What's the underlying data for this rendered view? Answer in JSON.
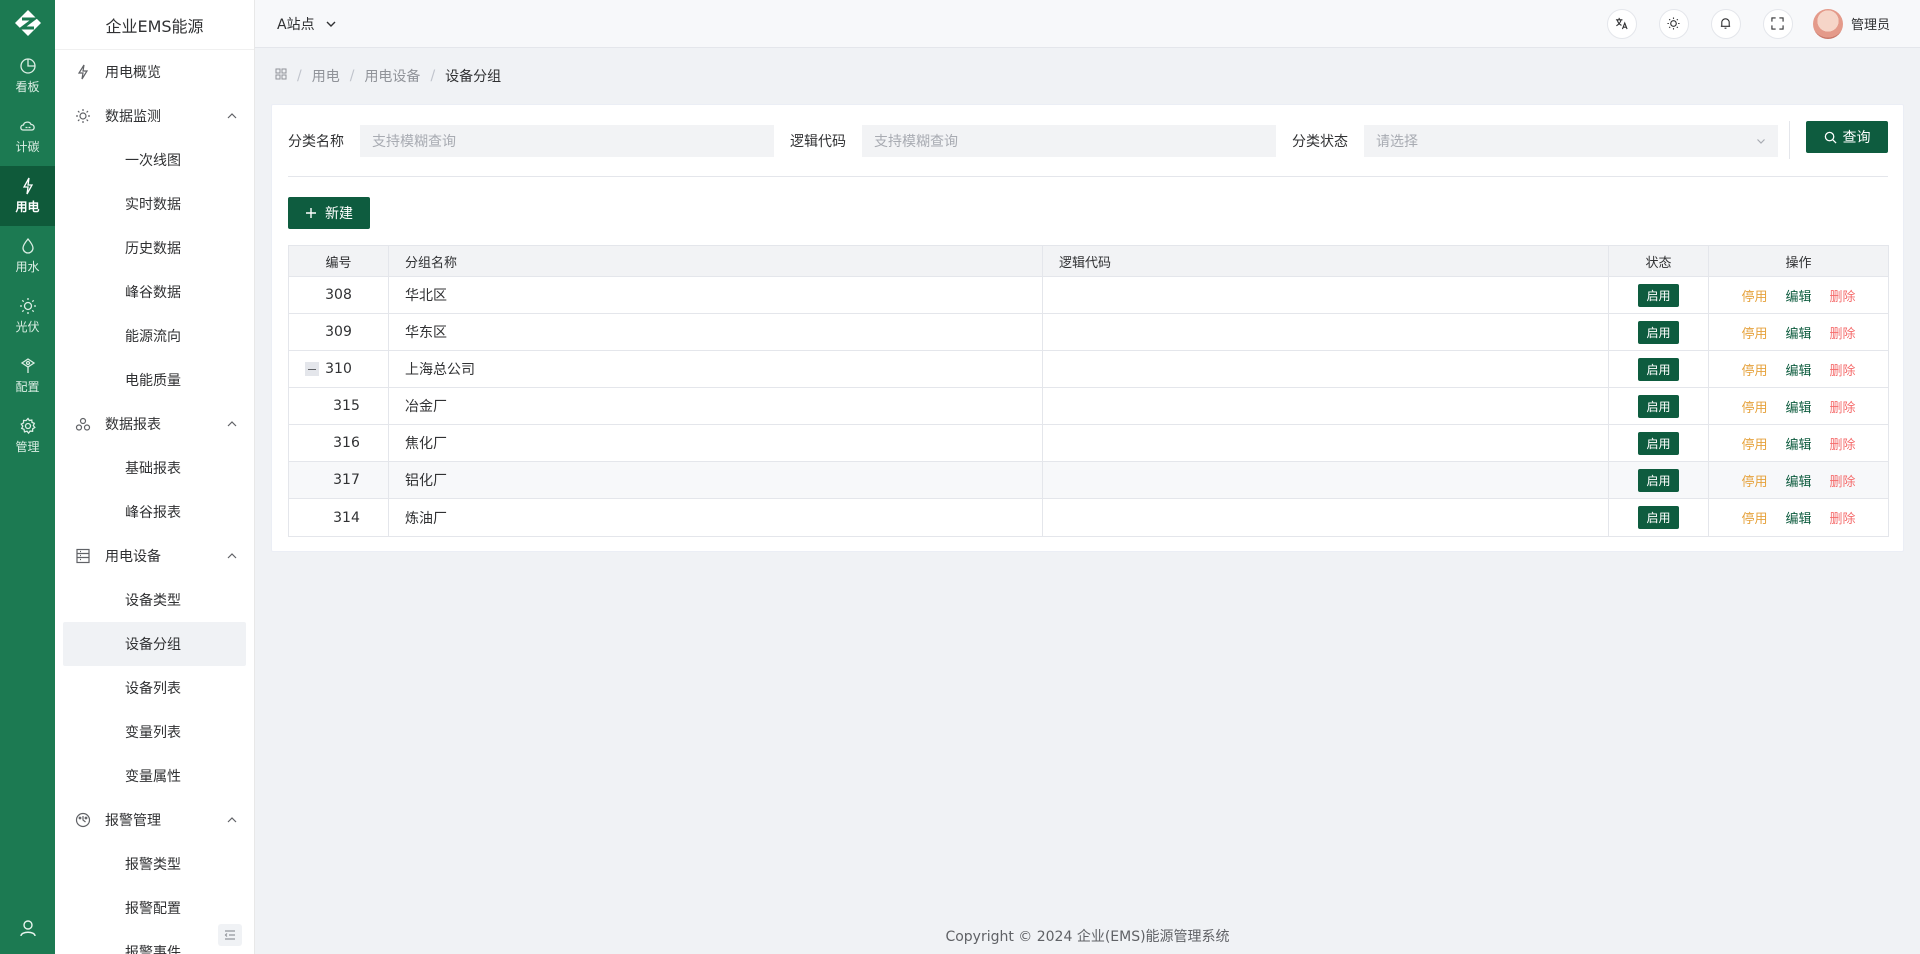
{
  "rail": {
    "items": [
      {
        "label": "看板",
        "icon": "dashboard-icon"
      },
      {
        "label": "计碳",
        "icon": "carbon-cloud-icon"
      },
      {
        "label": "用电",
        "icon": "electricity-icon",
        "active": true
      },
      {
        "label": "用水",
        "icon": "water-drop-icon"
      },
      {
        "label": "光伏",
        "icon": "sun-icon"
      },
      {
        "label": "配置",
        "icon": "config-icon"
      },
      {
        "label": "管理",
        "icon": "gear-icon"
      }
    ]
  },
  "sidebar": {
    "brand": "企业EMS能源",
    "groups": [
      {
        "label": "用电概览",
        "icon": "lightning-icon",
        "expandable": false,
        "children": []
      },
      {
        "label": "数据监测",
        "icon": "monitor-sun-icon",
        "expandable": true,
        "children": [
          "一次线图",
          "实时数据",
          "历史数据",
          "峰谷数据",
          "能源流向",
          "电能质量"
        ]
      },
      {
        "label": "数据报表",
        "icon": "report-icon",
        "expandable": true,
        "children": [
          "基础报表",
          "峰谷报表"
        ]
      },
      {
        "label": "用电设备",
        "icon": "device-list-icon",
        "expandable": true,
        "children": [
          "设备类型",
          "设备分组",
          "设备列表",
          "变量列表",
          "变量属性"
        ]
      },
      {
        "label": "报警管理",
        "icon": "alarm-icon",
        "expandable": true,
        "children": [
          "报警类型",
          "报警配置",
          "报警事件"
        ]
      }
    ],
    "active_sub": "设备分组"
  },
  "header": {
    "site": "A站点",
    "user_name": "管理员"
  },
  "breadcrumb": [
    "用电",
    "用电设备",
    "设备分组"
  ],
  "filters": {
    "category_name_label": "分类名称",
    "category_name_placeholder": "支持模糊查询",
    "logic_code_label": "逻辑代码",
    "logic_code_placeholder": "支持模糊查询",
    "status_label": "分类状态",
    "status_placeholder": "请选择",
    "query_label": "查询"
  },
  "new_button": "新建",
  "table": {
    "headers": [
      "编号",
      "分组名称",
      "逻辑代码",
      "状态",
      "操作"
    ],
    "rows": [
      {
        "id": "308",
        "name": "华北区",
        "code": "",
        "status": "启用",
        "level": 0,
        "toggle": false
      },
      {
        "id": "309",
        "name": "华东区",
        "code": "",
        "status": "启用",
        "level": 0,
        "toggle": false
      },
      {
        "id": "310",
        "name": "上海总公司",
        "code": "",
        "status": "启用",
        "level": 0,
        "toggle": true
      },
      {
        "id": "315",
        "name": "冶金厂",
        "code": "",
        "status": "启用",
        "level": 1,
        "toggle": false
      },
      {
        "id": "316",
        "name": "焦化厂",
        "code": "",
        "status": "启用",
        "level": 1,
        "toggle": false
      },
      {
        "id": "317",
        "name": "铝化厂",
        "code": "",
        "status": "启用",
        "level": 1,
        "toggle": false
      },
      {
        "id": "314",
        "name": "炼油厂",
        "code": "",
        "status": "启用",
        "level": 1,
        "toggle": false
      }
    ],
    "actions": {
      "stop": "停用",
      "edit": "编辑",
      "delete": "删除"
    }
  },
  "footer": "Copyright © 2024 企业(EMS)能源管理系统",
  "colors": {
    "primary": "#0e5c3f",
    "rail": "#1c7a52",
    "stop": "#e6a23c",
    "delete": "#f56c6c"
  }
}
